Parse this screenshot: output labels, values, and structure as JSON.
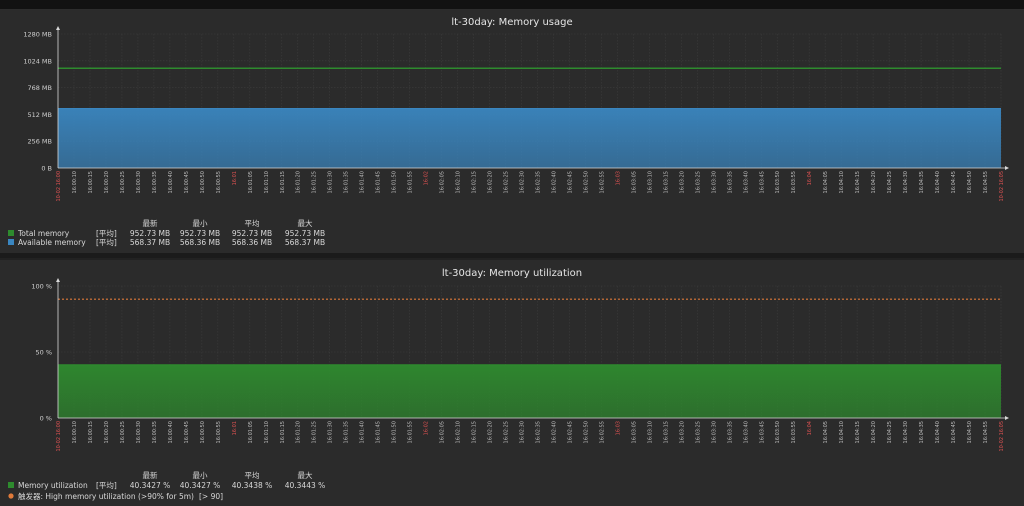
{
  "chart_data": [
    {
      "type": "area",
      "title": "lt-30day: Memory usage",
      "y_tick_labels": [
        "0 B",
        "256 MB",
        "512 MB",
        "768 MB",
        "1024 MB",
        "1280 MB"
      ],
      "ylim": [
        0,
        1280
      ],
      "y_unit": "MB",
      "x_start_label": "10-02 16:00",
      "x_end_label": "10-02 16:05",
      "x_labels": [
        "16:00:10",
        "16:00:15",
        "16:00:20",
        "16:00:25",
        "16:00:30",
        "16:00:35",
        "16:00:40",
        "16:00:45",
        "16:00:50",
        "16:00:55",
        "16:01",
        "16:01:05",
        "16:01:10",
        "16:01:15",
        "16:01:20",
        "16:01:25",
        "16:01:30",
        "16:01:35",
        "16:01:40",
        "16:01:45",
        "16:01:50",
        "16:01:55",
        "16:02",
        "16:02:05",
        "16:02:10",
        "16:02:15",
        "16:02:20",
        "16:02:25",
        "16:02:30",
        "16:02:35",
        "16:02:40",
        "16:02:45",
        "16:02:50",
        "16:02:55",
        "16:03",
        "16:03:05",
        "16:03:10",
        "16:03:15",
        "16:03:20",
        "16:03:25",
        "16:03:30",
        "16:03:35",
        "16:03:40",
        "16:03:45",
        "16:03:50",
        "16:03:55",
        "16:04",
        "16:04:05",
        "16:04:10",
        "16:04:15",
        "16:04:20",
        "16:04:25",
        "16:04:30",
        "16:04:35",
        "16:04:40",
        "16:04:45",
        "16:04:50",
        "16:04:55"
      ],
      "red_labels": [
        "16:01",
        "16:02",
        "16:03",
        "16:04"
      ],
      "grid": true,
      "legend_headers": [
        "最新",
        "最小",
        "平均",
        "最大"
      ],
      "series": [
        {
          "name": "Total memory",
          "func": "[平均]",
          "color": "#2e8b2e",
          "style": "line",
          "value": 952.73,
          "stats": [
            "952.73 MB",
            "952.73 MB",
            "952.73 MB",
            "952.73 MB"
          ]
        },
        {
          "name": "Available memory",
          "func": "[平均]",
          "color": "#3a86c0",
          "style": "area",
          "value": 568.37,
          "stats": [
            "568.37 MB",
            "568.36 MB",
            "568.36 MB",
            "568.37 MB"
          ]
        }
      ]
    },
    {
      "type": "area",
      "title": "lt-30day: Memory utilization",
      "y_tick_labels": [
        "0 %",
        "50 %",
        "100 %"
      ],
      "ylim": [
        0,
        100
      ],
      "y_unit": "%",
      "x_start_label": "10-02 16:00",
      "x_end_label": "10-02 16:05",
      "x_labels": [
        "16:00:10",
        "16:00:15",
        "16:00:20",
        "16:00:25",
        "16:00:30",
        "16:00:35",
        "16:00:40",
        "16:00:45",
        "16:00:50",
        "16:00:55",
        "16:01",
        "16:01:05",
        "16:01:10",
        "16:01:15",
        "16:01:20",
        "16:01:25",
        "16:01:30",
        "16:01:35",
        "16:01:40",
        "16:01:45",
        "16:01:50",
        "16:01:55",
        "16:02",
        "16:02:05",
        "16:02:10",
        "16:02:15",
        "16:02:20",
        "16:02:25",
        "16:02:30",
        "16:02:35",
        "16:02:40",
        "16:02:45",
        "16:02:50",
        "16:02:55",
        "16:03",
        "16:03:05",
        "16:03:10",
        "16:03:15",
        "16:03:20",
        "16:03:25",
        "16:03:30",
        "16:03:35",
        "16:03:40",
        "16:03:45",
        "16:03:50",
        "16:03:55",
        "16:04",
        "16:04:05",
        "16:04:10",
        "16:04:15",
        "16:04:20",
        "16:04:25",
        "16:04:30",
        "16:04:35",
        "16:04:40",
        "16:04:45",
        "16:04:50",
        "16:04:55"
      ],
      "red_labels": [
        "16:01",
        "16:02",
        "16:03",
        "16:04"
      ],
      "grid": true,
      "legend_headers": [
        "最新",
        "最小",
        "平均",
        "最大"
      ],
      "series": [
        {
          "name": "Memory utilization",
          "func": "[平均]",
          "color": "#2e8b2e",
          "style": "area",
          "value": 40.3427,
          "stats": [
            "40.3427 %",
            "40.3427 %",
            "40.3438 %",
            "40.3443 %"
          ]
        }
      ],
      "trigger": {
        "label": "触发器: High memory utilization (>90% for 5m)",
        "condition": "[> 90]",
        "value": 90,
        "color": "#e07a3a"
      }
    }
  ]
}
